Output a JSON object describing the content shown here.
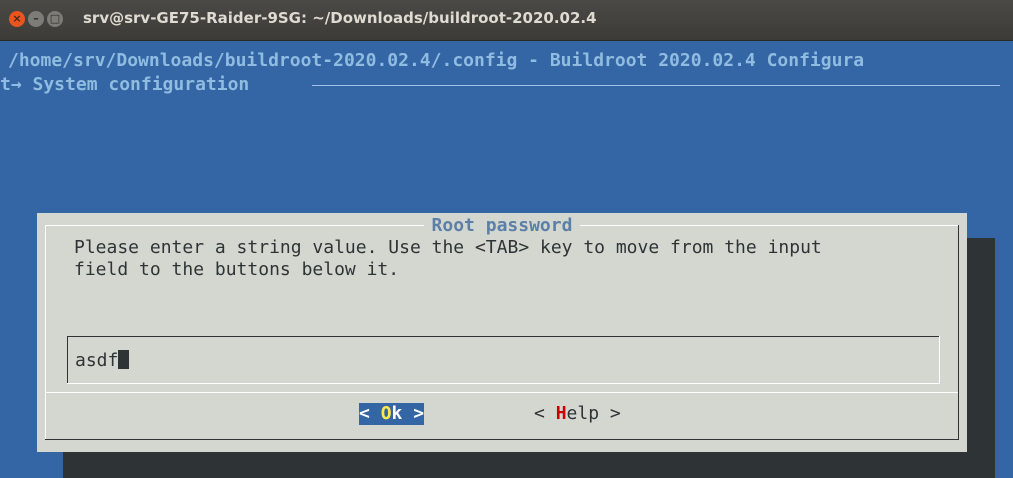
{
  "window": {
    "title": "srv@srv-GE75-Raider-9SG: ~/Downloads/buildroot-2020.02.4",
    "close_glyph": "×",
    "min_glyph": "–",
    "max_glyph": "□"
  },
  "terminal": {
    "config_path": "/home/srv/Downloads/buildroot-2020.02.4/.config - Buildroot 2020.02.4 Configura",
    "breadcrumb": "t→ System configuration"
  },
  "dialog": {
    "title": "Root password",
    "prompt": "Please enter a string value. Use the <TAB> key to move from the input\nfield to the buttons below it.",
    "input_value": "asdf",
    "ok_button": {
      "left": "< ",
      "hotkey": "O",
      "rest": "k",
      "right": " >"
    },
    "help_button": {
      "left": "< ",
      "hotkey": "H",
      "rest": "elp",
      "right": " >"
    }
  },
  "colors": {
    "terminal_bg": "#3465a4",
    "dialog_bg": "#d3d7cf",
    "ok_selected_bg": "#3465a4",
    "ok_hotkey": "#fce94f",
    "help_hotkey": "#cc0000"
  }
}
